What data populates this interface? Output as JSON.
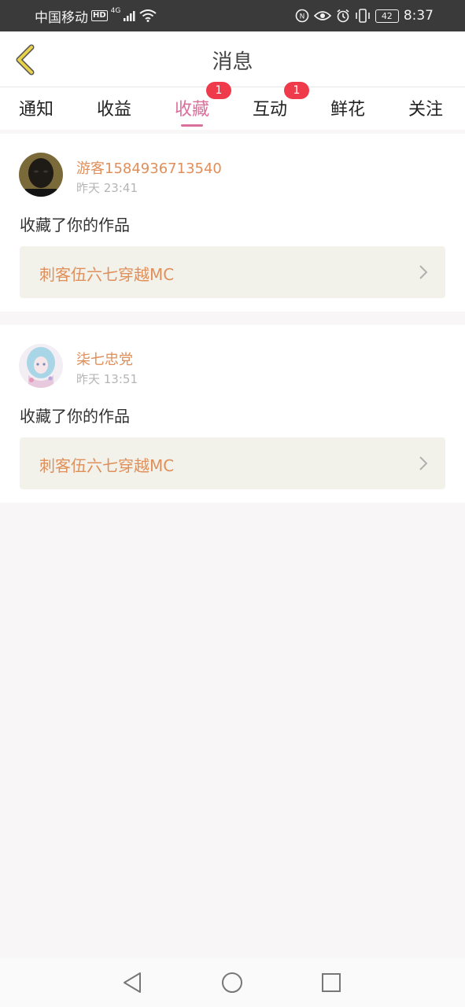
{
  "status_bar": {
    "carrier": "中国移动",
    "network_hd": "HD",
    "network_type": "4G",
    "battery": "42",
    "time": "8:37"
  },
  "header": {
    "title": "消息",
    "back_icon": "chevron-left-icon"
  },
  "tabs": [
    {
      "label": "通知",
      "badge": ""
    },
    {
      "label": "收益",
      "badge": ""
    },
    {
      "label": "收藏",
      "badge": "1",
      "active": true
    },
    {
      "label": "互动",
      "badge": "1"
    },
    {
      "label": "鲜花",
      "badge": ""
    },
    {
      "label": "关注",
      "badge": ""
    }
  ],
  "messages": [
    {
      "username": "游客1584936713540",
      "time": "昨天 23:41",
      "action": "收藏了你的作品",
      "work_title": "刺客伍六七穿越MC"
    },
    {
      "username": "柒七忠党",
      "time": "昨天 13:51",
      "action": "收藏了你的作品",
      "work_title": "刺客伍六七穿越MC"
    }
  ],
  "colors": {
    "accent": "#d9709b",
    "badge": "#ee3a4a",
    "username": "#e08f5a",
    "back_icon": "#e8d24a"
  }
}
